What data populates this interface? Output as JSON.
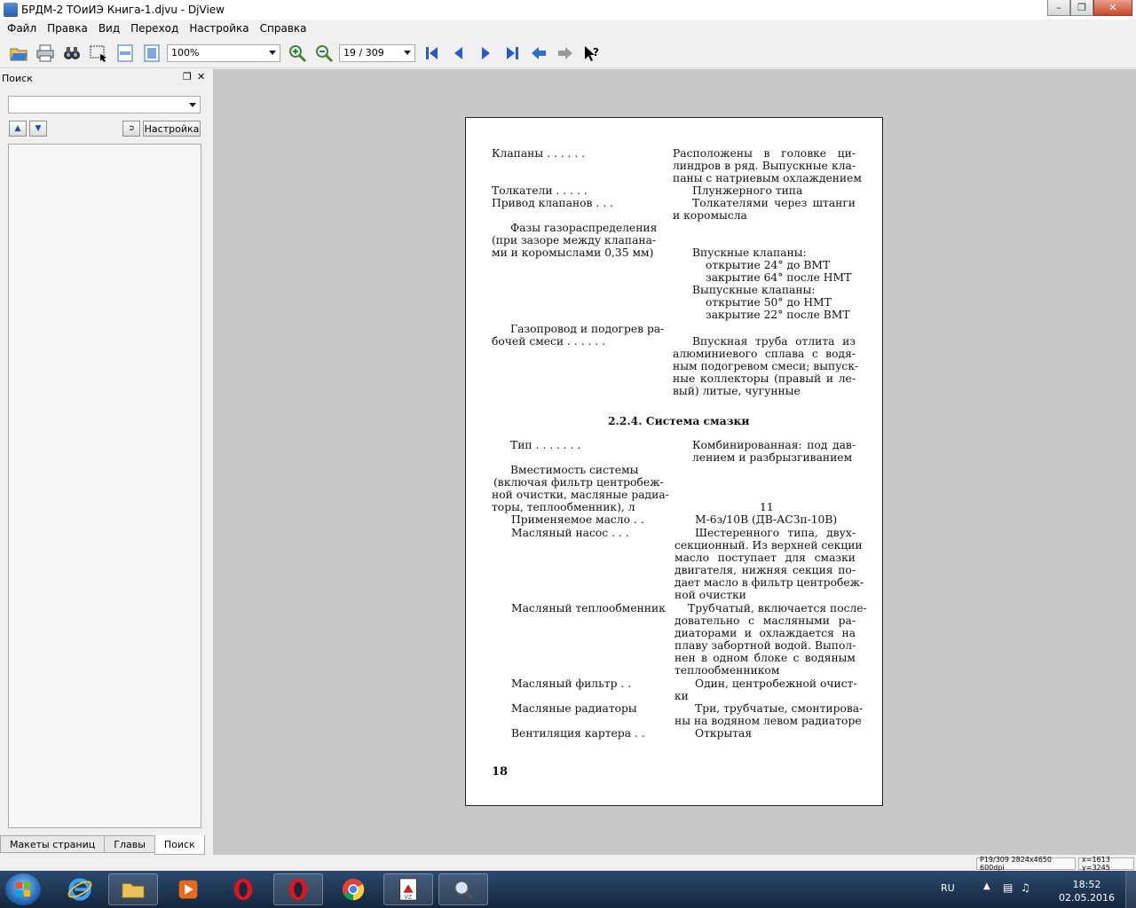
{
  "window": {
    "title": "БРДМ-2 ТОиИЭ Книга-1.djvu - DjView"
  },
  "menu": [
    "Файл",
    "Правка",
    "Вид",
    "Переход",
    "Настройка",
    "Справка"
  ],
  "toolbar": {
    "zoom": "100%",
    "page": "19 / 309"
  },
  "sidebar": {
    "title": "Поиск",
    "search_value": "",
    "settings_label": "Настройка",
    "tabs": [
      "Макеты страниц",
      "Главы",
      "Поиск"
    ]
  },
  "page": {
    "heading": "2.2.4. Система смазки",
    "page_number": "18",
    "left_lines": [
      "Клапаны . . . . . .",
      "Толкатели . . . . .",
      "Привод клапанов . . .",
      "Фазы газораспределения",
      "(при зазоре между клапана-",
      "ми и коромыслами 0,35 мм)",
      "Газопровод и подогрев ра-",
      "бочей смеси . . . . . .",
      "Тип . . . . . . .",
      "Вместимость системы",
      "(включая фильтр центробеж-",
      "ной очистки, масляные радиа-",
      "торы, теплообменник), л",
      "Применяемое масло . .",
      "Масляный насос . . .",
      "Масляный теплообменник",
      "Масляный фильтр . .",
      "Масляные радиаторы",
      "Вентиляция картера . ."
    ],
    "right_lines": [
      "Расположены в головке ци-",
      "линдров в ряд. Выпускные кла-",
      "паны с натриевым охлаждением",
      "Плунжерного типа",
      "Толкателями через штанги",
      "и коромысла",
      "Впускные клапаны:",
      "открытие 24° до ВМТ",
      "закрытие 64° после НМТ",
      "Выпускные клапаны:",
      "открытие 50° до НМТ",
      "закрытие 22° после ВМТ",
      "Впускная труба отлита из",
      "алюминиевого сплава с водя-",
      "ным подогревом смеси; выпуск-",
      "ные коллекторы (правый и ле-",
      "вый) литые, чугунные",
      "Комбинированная: под дав-",
      "лением и разбрызгиванием",
      "11",
      "М-6з/10В (ДВ-АСЗп-10В)",
      "Шестеренного типа, двух-",
      "секционный. Из верхней секции",
      "масло поступает для смазки",
      "двигателя, нижняя секция по-",
      "дает масло в фильтр центробеж-",
      "ной очистки",
      "Трубчатый, включается после-",
      "довательно с масляными ра-",
      "диаторами и охлаждается на",
      "плаву забортной водой. Выпол-",
      "нен в одном блоке с водяным",
      "теплообменником",
      "Один, центробежной очист-",
      "ки",
      "Три, трубчатые, смонтирова-",
      "ны на водяном левом радиаторе",
      "Открытая"
    ]
  },
  "status": {
    "page_info": "P19/309 2824x4650 600dpi",
    "coords": "x=1613 y=3245"
  },
  "taskbar": {
    "lang": "RU",
    "time": "18:52",
    "date": "02.05.2016"
  },
  "colors": {
    "doc_background": "#c8c8c8",
    "taskbar": "#1d3553"
  }
}
